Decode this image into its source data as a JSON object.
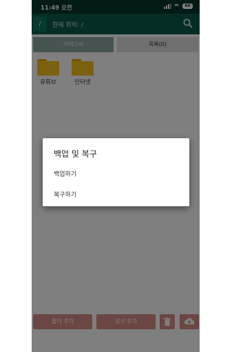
{
  "status": {
    "time": "11:49 오전",
    "battery": "66"
  },
  "toolbar": {
    "root_label": "/",
    "path_text": "현재 위치: /",
    "search_icon": "search-icon"
  },
  "tabs": {
    "category": "카테고리",
    "list": "목록(0)"
  },
  "folders": [
    {
      "name": "유튜브"
    },
    {
      "name": "인터넷"
    }
  ],
  "bottom_bar": {
    "add_folder": "폴더 추가",
    "add_link": "링크 추가",
    "delete_icon": "trash-icon",
    "backup_icon": "cloud-upload-icon"
  },
  "dialog": {
    "title": "백업 및 복구",
    "items": [
      "백업하기",
      "복구하기"
    ]
  },
  "colors": {
    "status_bar": "#07362c",
    "toolbar": "#0a5b4d",
    "folder": "#f7c21b",
    "button": "#d98d86"
  }
}
